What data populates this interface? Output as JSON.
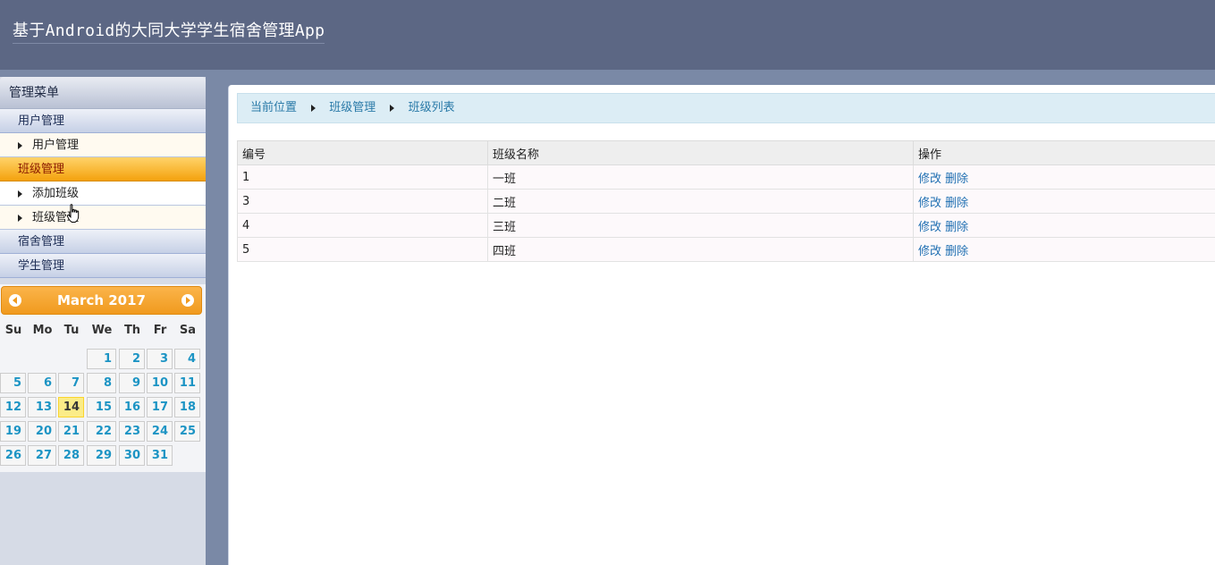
{
  "app": {
    "title": "基于Android的大同大学学生宿舍管理App"
  },
  "sidebar": {
    "menu_title": "管理菜单",
    "groups": [
      {
        "label": "用户管理",
        "items": [
          "用户管理"
        ]
      },
      {
        "label": "班级管理",
        "active": true,
        "items": [
          "添加班级",
          "班级管理"
        ]
      },
      {
        "label": "宿舍管理",
        "items": []
      },
      {
        "label": "学生管理",
        "items": []
      }
    ]
  },
  "calendar": {
    "month_label": "March 2017",
    "weekdays": [
      "Su",
      "Mo",
      "Tu",
      "We",
      "Th",
      "Fr",
      "Sa"
    ],
    "first_weekday_index": 3,
    "days_in_month": 31,
    "today": 14
  },
  "breadcrumb": {
    "items": [
      "当前位置",
      "班级管理",
      "班级列表"
    ]
  },
  "table": {
    "headers": [
      "编号",
      "班级名称",
      "操作"
    ],
    "rows": [
      {
        "id": "1",
        "name": "一班",
        "edit": "修改",
        "delete": "删除"
      },
      {
        "id": "3",
        "name": "二班",
        "edit": "修改",
        "delete": "删除"
      },
      {
        "id": "4",
        "name": "三班",
        "edit": "修改",
        "delete": "删除"
      },
      {
        "id": "5",
        "name": "四班",
        "edit": "修改",
        "delete": "删除"
      }
    ]
  },
  "colors": {
    "header_bg": "#5c6784",
    "active_group": "#f4a20d",
    "link": "#1f6fb2"
  }
}
